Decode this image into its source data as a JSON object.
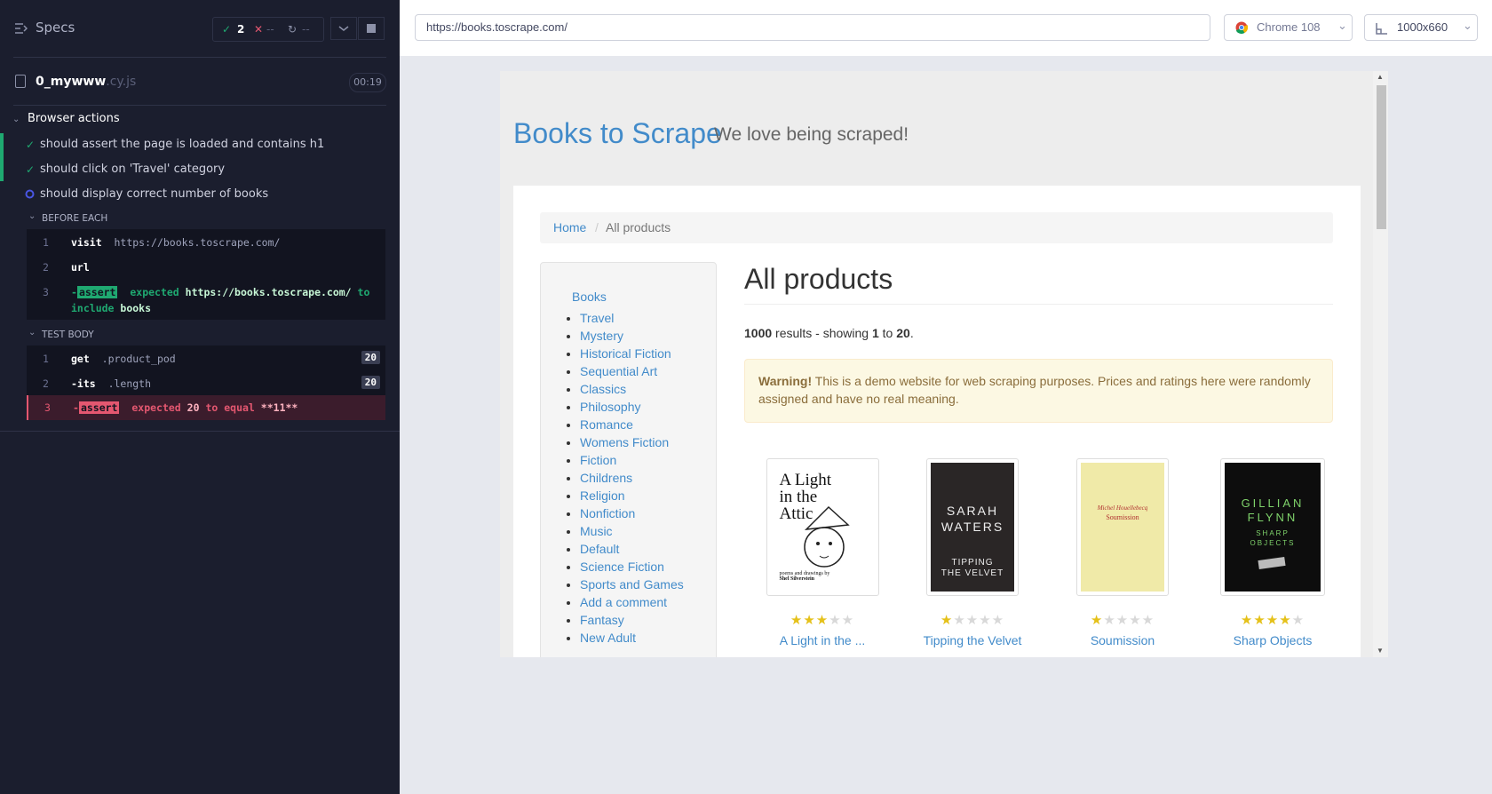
{
  "runner": {
    "specs_label": "Specs",
    "passed_count": "2",
    "failed_count": "--",
    "pending_count": "--",
    "spec_file": "0_mywww",
    "spec_ext": ".cy.js",
    "duration": "00:19",
    "suite": "Browser actions",
    "tests": [
      {
        "title": "should assert the page is loaded and contains h1",
        "state": "passed"
      },
      {
        "title": "should click on 'Travel' category",
        "state": "passed"
      },
      {
        "title": "should display correct number of books",
        "state": "running"
      }
    ],
    "before_each_label": "BEFORE EACH",
    "before_each": [
      {
        "num": "1",
        "name": "visit",
        "arg": "https://books.toscrape.com/"
      },
      {
        "num": "2",
        "name": "url",
        "arg": ""
      },
      {
        "num": "3",
        "name": "assert",
        "line1_a": "expected",
        "line1_b": "https://books.toscrape.com/",
        "line1_c": "to",
        "line2_a": "include",
        "line2_b": "books"
      }
    ],
    "test_body_label": "TEST BODY",
    "test_body": [
      {
        "num": "1",
        "name": "get",
        "arg": ".product_pod",
        "badge": "20"
      },
      {
        "num": "2",
        "name": "-its",
        "arg": ".length",
        "badge": "20"
      },
      {
        "num": "3",
        "name": "assert",
        "text_a": "expected",
        "text_b": "20",
        "text_c": "to equal",
        "text_d": "**11**"
      }
    ]
  },
  "browser": {
    "url": "https://books.toscrape.com/",
    "browser_name": "Chrome 108",
    "viewport": "1000x660"
  },
  "site": {
    "brand": "Books to Scrape",
    "tagline": "We love being scraped!",
    "breadcrumb": [
      "Home",
      "All products"
    ],
    "breadcrumb_sep": "/",
    "sidebar_top": "Books",
    "categories": [
      "Travel",
      "Mystery",
      "Historical Fiction",
      "Sequential Art",
      "Classics",
      "Philosophy",
      "Romance",
      "Womens Fiction",
      "Fiction",
      "Childrens",
      "Religion",
      "Nonfiction",
      "Music",
      "Default",
      "Science Fiction",
      "Sports and Games",
      "Add a comment",
      "Fantasy",
      "New Adult"
    ],
    "heading": "All products",
    "results": {
      "total": "1000",
      "mid": "results - showing",
      "from": "1",
      "to_word": "to",
      "to": "20",
      "end": "."
    },
    "warning_strong": "Warning!",
    "warning_text": "This is a demo website for web scraping purposes. Prices and ratings here were randomly assigned and have no real meaning.",
    "products": [
      {
        "title": "A Light in the ...",
        "rating": 3,
        "cover_text": "A Light in the Attic"
      },
      {
        "title": "Tipping the Velvet",
        "rating": 1,
        "cover_text": "SARAH WATERS TIPPING THE VELVET"
      },
      {
        "title": "Soumission",
        "rating": 1,
        "cover_text": "Michel Houellebecq Soumission"
      },
      {
        "title": "Sharp Objects",
        "rating": 4,
        "cover_text": "GILLIAN FLYNN SHARP OBJECTS"
      }
    ]
  },
  "colors": {
    "pass": "#1fa971",
    "fail": "#e45770",
    "link": "#428bca",
    "star": "#e5c11a"
  }
}
